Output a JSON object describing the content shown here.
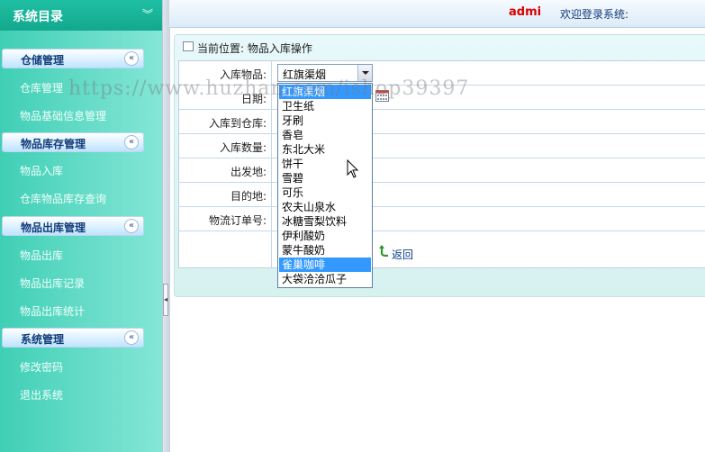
{
  "sidebar": {
    "title": "系统目录",
    "sections": [
      {
        "label": "仓储管理",
        "toggle": "«",
        "items": [
          "仓库管理",
          "物品基础信息管理"
        ]
      },
      {
        "label": "物品库存管理",
        "toggle": "«",
        "items": [
          "物品入库",
          "仓库物品库存查询"
        ]
      },
      {
        "label": "物品出库管理",
        "toggle": "«",
        "items": [
          "物品出库",
          "物品出库记录",
          "物品出库统计"
        ]
      },
      {
        "label": "系统管理",
        "toggle": "«",
        "items": [
          "修改密码",
          "退出系统"
        ]
      }
    ]
  },
  "header": {
    "welcome": "欢迎登录系统:",
    "user": "admi"
  },
  "breadcrumb": "当前位置: 物品入库操作",
  "form": {
    "labels": [
      "入库物品:",
      "日期:",
      "入库到仓库:",
      "入库数量:",
      "出发地:",
      "目的地:",
      "物流订单号:"
    ],
    "item_select": {
      "value": "红旗渠烟",
      "options": [
        "红旗渠烟",
        "卫生纸",
        "牙刷",
        "香皂",
        "东北大米",
        "饼干",
        "雪碧",
        "可乐",
        "农夫山泉水",
        "冰糖雪梨饮料",
        "伊利酸奶",
        "蒙牛酸奶",
        "雀巢咖啡",
        "大袋洽洽瓜子"
      ],
      "highlighted": "雀巢咖啡"
    },
    "back": "返回"
  },
  "watermark": "https://www.huzhan.com/ishop39397",
  "colors": {
    "sidebar": "#3fcfb5",
    "highlight": "#3399ff",
    "user": "#d90000"
  }
}
